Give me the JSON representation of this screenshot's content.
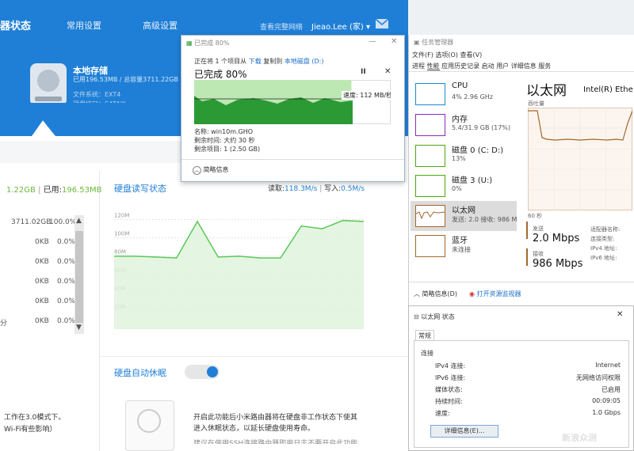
{
  "router": {
    "header": {
      "title": "器状态",
      "tabs": [
        "常用设置",
        "高级设置"
      ],
      "link": "查看完整网络",
      "user": "Jieao.Lee (家)"
    },
    "storage": {
      "title": "本地存储",
      "usage": "已用196.53MB / 总容量3711.22GB",
      "fs": "文件系统：EXT4",
      "iface": "硬盘接口：SATAIII"
    },
    "usage_bar": {
      "left": "1.22GB",
      "used_label": "已用:",
      "used_value": "196.53MB"
    },
    "table": {
      "rows": [
        {
          "size": "3711.02GB",
          "pct": "100.0%"
        },
        {
          "size": "0KB",
          "pct": "0.0%"
        },
        {
          "size": "0KB",
          "pct": "0.0%"
        },
        {
          "size": "0KB",
          "pct": "0.0%"
        },
        {
          "size": "0KB",
          "pct": "0.0%"
        },
        {
          "size": "0KB",
          "pct": "0.0%",
          "prefix": "分"
        }
      ]
    },
    "rw": {
      "title": "硬盘读写状态",
      "read_label": "读取:",
      "read_value": "118.3M/s",
      "write_label": "写入:",
      "write_value": "0.5M/s"
    },
    "sleep": {
      "title": "硬盘自动休眠",
      "enabled": true
    },
    "desc": {
      "left1": "工作在3.0模式下。",
      "left2": "Wi-Fi有些影响）",
      "p1": "开启此功能后小米路由器将在硬盘非工作状态下使其",
      "p2": "进入休眠状态，以延长硬盘使用寿命。",
      "p3": "建议在使用SSH连接路由器即用日志不要开启此功能"
    }
  },
  "chart_data": {
    "type": "area",
    "title": "硬盘读写状态",
    "ylabels": [
      "120M",
      "100M",
      "80M",
      "60M",
      "40M",
      "20M"
    ],
    "ylim": [
      0,
      130
    ],
    "series": [
      {
        "name": "读取",
        "values": [
          80,
          80,
          79,
          78,
          118,
          79,
          80,
          78,
          78,
          113,
          110,
          119,
          118
        ]
      }
    ]
  },
  "copy": {
    "title": "已完成 80%",
    "line1_prefix": "正在将 1 个项目从",
    "line1_src": "下载",
    "line1_mid": "复制到",
    "line1_dst": "本地磁盘 (D:)",
    "progress": "已完成 80%",
    "progress_value": 0.8,
    "speed": "速度: 112 MB/秒",
    "name": "名称: win10m.GHO",
    "remaining_time": "剩余时间: 大约 30 秒",
    "remaining_items": "剩余项目: 1 (2.50 GB)",
    "less": "简略信息"
  },
  "taskmgr": {
    "title": "任务管理器",
    "menu": [
      "文件(F)",
      "选项(O)",
      "查看(V)"
    ],
    "tabs": [
      "进程",
      "性能",
      "应用历史记录",
      "启动",
      "用户",
      "详细信息",
      "服务"
    ],
    "items": [
      {
        "name": "CPU",
        "sub": "4% 2.96 GHz",
        "color": "#1a8ad4"
      },
      {
        "name": "内存",
        "sub": "5.4/31.9 GB (17%)",
        "color": "#8b2cb5"
      },
      {
        "name": "磁盘 0 (C: D:)",
        "sub": "13%",
        "color": "#4da60c"
      },
      {
        "name": "磁盘 3 (U:)",
        "sub": "0%",
        "color": "#4da60c"
      },
      {
        "name": "以太网",
        "sub": "发送: 2.0 接收: 986 M",
        "color": "#a5672b"
      },
      {
        "name": "蓝牙",
        "sub": "未连接",
        "color": "#a5672b"
      }
    ],
    "detail": {
      "title": "以太网",
      "adapter": "Intel(R) Ethe",
      "throughput": "吞吐量",
      "time": "60 秒",
      "send_label": "发送",
      "send_value": "2.0 Mbps",
      "recv_label": "接收",
      "recv_value": "986 Mbps",
      "props": [
        "适配器名称:",
        "连接类型:",
        "IPv4 地址:",
        "IPv6 地址:"
      ]
    },
    "footer_less": "简略信息(D)",
    "footer_monitor": "打开资源监视器"
  },
  "eth_status": {
    "title": "以太网 状态",
    "tab": "常规",
    "section": "连接",
    "rows": [
      {
        "k": "IPv4 连接:",
        "v": "Internet"
      },
      {
        "k": "IPv6 连接:",
        "v": "无网络访问权限"
      },
      {
        "k": "媒体状态:",
        "v": "已启用"
      },
      {
        "k": "持续时间:",
        "v": "00:09:05"
      },
      {
        "k": "速度:",
        "v": "1.0 Gbps"
      }
    ],
    "details_button": "详细信息(E)...",
    "watermark": "新浪众测"
  }
}
